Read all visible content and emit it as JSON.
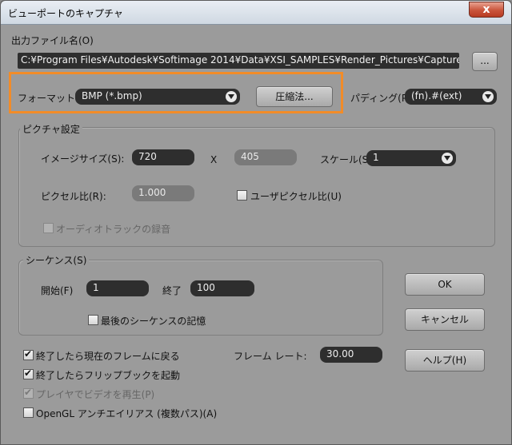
{
  "window": {
    "title": "ビューポートのキャプチャ",
    "close_label": "x"
  },
  "output": {
    "label": "出力ファイル名(O)",
    "path": "C:¥Program Files¥Autodesk¥Softimage 2014¥Data¥XSI_SAMPLES¥Render_Pictures¥Capture.bmp",
    "browse_label": "..."
  },
  "format": {
    "label": "フォーマット(F)",
    "value": "BMP (*.bmp)",
    "compress_label": "圧縮法..."
  },
  "padding": {
    "label": "パディング(P)",
    "value": "(fn).#(ext)"
  },
  "picture": {
    "title": "ピクチャ設定",
    "image_size_label": "イメージサイズ(S):",
    "width": "720",
    "x_label": "X",
    "height": "405",
    "scale_label": "スケール(S)",
    "scale_value": "1",
    "pixel_ratio_label": "ピクセル比(R):",
    "pixel_ratio_value": "1.000",
    "user_pixel_ratio_label": "ユーザピクセル比(U)",
    "audio_track_label": "オーディオトラックの録音"
  },
  "sequence": {
    "title": "シーケンス(S)",
    "start_label": "開始(F)",
    "start_value": "1",
    "end_label": "終了",
    "end_value": "100",
    "remember_label": "最後のシーケンスの記憶"
  },
  "options": {
    "return_frame_label": "終了したら現在のフレームに戻る",
    "launch_flipbook_label": "終了したらフリップブックを起動",
    "player_label": "プレイヤでビデオを再生(P)",
    "opengl_aa_label": "OpenGL アンチエイリアス (複数パス)(A)",
    "frame_rate_label": "フレーム レート:",
    "frame_rate_value": "30.00"
  },
  "buttons": {
    "ok": "OK",
    "cancel": "キャンセル",
    "help": "ヘルプ(H)"
  },
  "colors": {
    "highlight": "#f28c28",
    "field_bg": "#2e2e2e",
    "dialog_bg": "#9b9b9b"
  }
}
